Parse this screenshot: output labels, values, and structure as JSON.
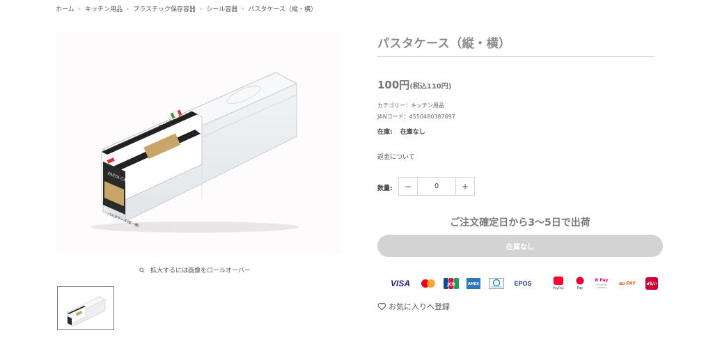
{
  "breadcrumb": [
    "ホーム",
    "キッチン用品",
    "プラスチック保存容器",
    "シール容器",
    "パスタケース（縦・横）"
  ],
  "breadcrumb_separator": "›",
  "product": {
    "title": "パスタケース（縦・横）",
    "price_main": "100円",
    "price_tax": "(税込110円)",
    "category": "カテゴリー：キッチン用品",
    "jan": "JANコード：4550480387697",
    "stock_label": "在庫:",
    "stock_value": "在庫なし",
    "refund_link": "返金について",
    "quantity_label": "数量:",
    "quantity_value": "0",
    "quantity_minus": "−",
    "quantity_plus": "+",
    "shipping_note": "ご注文確定日から3〜5日で出荷",
    "sold_out_button": "在庫なし",
    "favorite": "お気に入りへ登録"
  },
  "image": {
    "zoom_hint": "拡大するには画像をロールオーバー",
    "package_text_main": "PASTA CASE",
    "package_text_side": "PASTA CASE",
    "package_label": "パスタケース(縦・横)"
  },
  "payments": {
    "visa": "VISA",
    "jcb": "JCB",
    "amex": "AMEX",
    "epos": "EPOS",
    "paypay": "PayPay",
    "merpay": "Pay",
    "bpay": "B Pay",
    "aupay": "au PAY",
    "dbarai": "d払い"
  },
  "colors": {
    "title": "#8a8a8a",
    "soldout_bg": "#d3d3d3",
    "visa": "#1a1f71",
    "mastercard_red": "#eb001b",
    "mastercard_yellow": "#f79e1b",
    "paypay": "#ff0033",
    "aupay": "#eb5505",
    "dbarai": "#cc0033"
  }
}
